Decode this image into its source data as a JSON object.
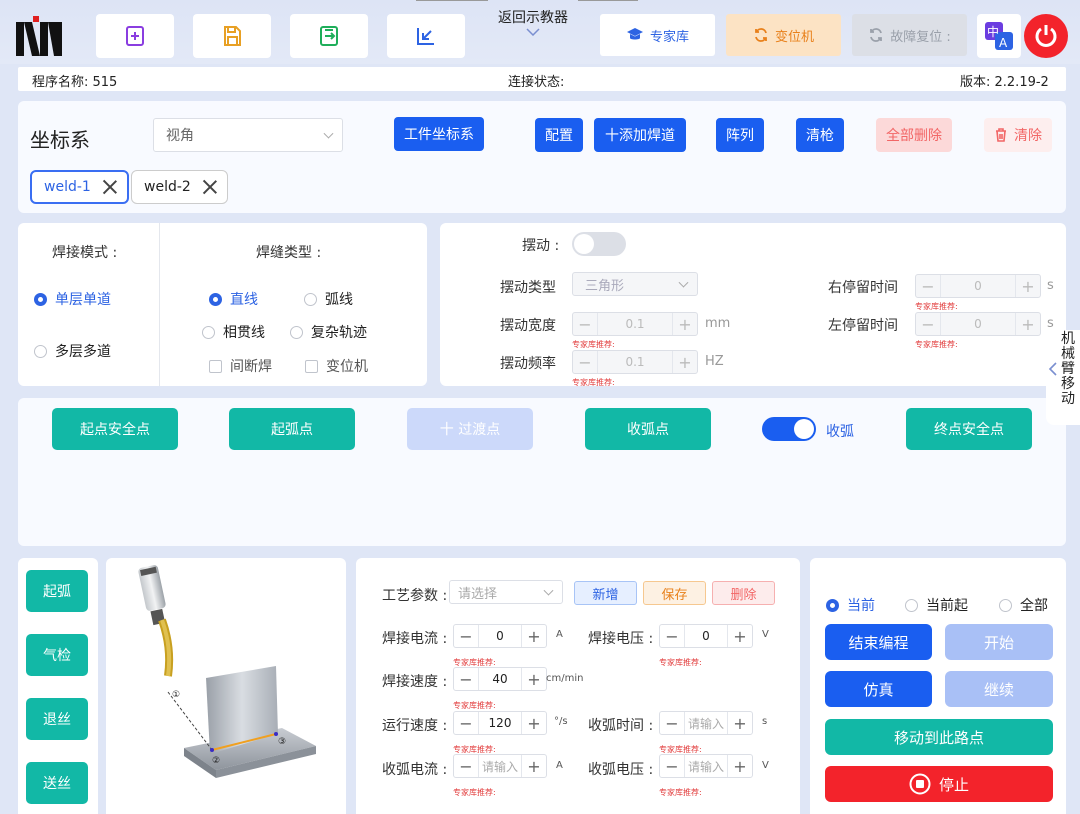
{
  "header": {
    "teach_tab": "返回示教器",
    "expert_btn": "专家库",
    "positioner_btn": "变位机",
    "fault_reset_btn": "故障复位 :"
  },
  "infobar": {
    "program_name": "程序名称: 515",
    "connection": "连接状态:",
    "version": "版本: 2.2.19-2"
  },
  "coord": {
    "title": "坐标系",
    "view_select": "视角",
    "workpiece_btn": "工件坐标系",
    "config_btn": "配置",
    "add_weld_btn": "十添加焊道",
    "array_btn": "阵列",
    "clean_gun_btn": "清枪",
    "delete_all_btn": "全部删除",
    "clear_btn": "清除",
    "tabs": [
      "weld-1",
      "weld-2"
    ]
  },
  "weld_mode": {
    "title": "焊接模式 :",
    "options": [
      "单层单道",
      "多层多道"
    ],
    "selected": 0
  },
  "seam_type": {
    "title": "焊缝类型 :",
    "line": "直线",
    "arc": "弧线",
    "intersect": "相贯线",
    "complex": "复杂轨迹",
    "intermittent": "间断焊",
    "positioner": "变位机"
  },
  "weave": {
    "title": "摆动 :",
    "type_label": "摆动类型",
    "type_value": "三角形",
    "width_label": "摆动宽度",
    "width_value": "0.1",
    "width_unit": "mm",
    "freq_label": "摆动频率",
    "freq_value": "0.1",
    "freq_unit": "HZ",
    "right_dwell_label": "右停留时间",
    "right_dwell_value": "0",
    "left_dwell_label": "左停留时间",
    "left_dwell_value": "0",
    "dwell_unit": "s",
    "hint": "专家库推荐:",
    "enabled": false
  },
  "points": {
    "start_safe": "起点安全点",
    "arc_start": "起弧点",
    "transition": "十 过渡点",
    "arc_end": "收弧点",
    "arc_end_toggle": "收弧",
    "end_safe": "终点安全点",
    "arc_end_enabled": true
  },
  "drawer": {
    "label": "机械臂移动"
  },
  "left_buttons": [
    "起弧",
    "气检",
    "退丝",
    "送丝"
  ],
  "diagram_labels": [
    "①",
    "②",
    "③"
  ],
  "process": {
    "label": "工艺参数 :",
    "select_placeholder": "请选择",
    "new_btn": "新增",
    "save_btn": "保存",
    "delete_btn": "删除",
    "current_label": "焊接电流 :",
    "current_value": "0",
    "current_unit": "A",
    "voltage_label": "焊接电压 :",
    "voltage_value": "0",
    "voltage_unit": "V",
    "speed_label": "焊接速度 :",
    "speed_value": "40",
    "speed_unit": "cm/min",
    "run_speed_label": "运行速度 :",
    "run_speed_value": "120",
    "run_speed_unit": "°/s",
    "arc_time_label": "收弧时间 :",
    "arc_time_placeholder": "请输入",
    "arc_time_unit": "s",
    "arc_current_label": "收弧电流 :",
    "arc_current_placeholder": "请输入",
    "arc_current_unit": "A",
    "arc_voltage_label": "收弧电压 :",
    "arc_voltage_placeholder": "请输入",
    "arc_voltage_unit": "V",
    "hint": "专家库推荐:"
  },
  "run": {
    "scope_options": [
      "当前",
      "当前起",
      "全部"
    ],
    "scope_selected": 0,
    "end_program_btn": "结束编程",
    "start_btn": "开始",
    "simulate_btn": "仿真",
    "continue_btn": "继续",
    "move_to_btn": "移动到此路点",
    "stop_btn": "停止"
  },
  "colors": {
    "primary": "#1a5ef0",
    "teal": "#12b8a6",
    "danger": "#f3232b",
    "hint": "#e23c3c"
  }
}
